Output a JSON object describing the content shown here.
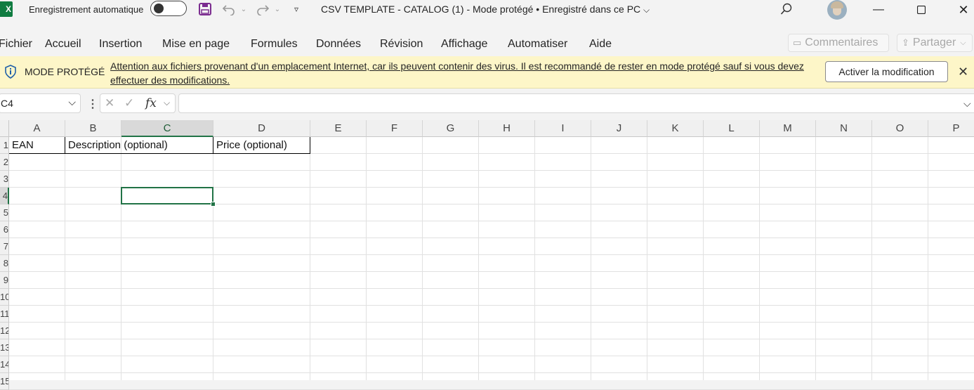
{
  "titlebar": {
    "app_badge": "X",
    "autosave_label": "Enregistrement automatique",
    "doc_title": "CSV TEMPLATE - CATALOG (1)  -  Mode protégé • Enregistré dans ce PC"
  },
  "menu": {
    "items": [
      "Fichier",
      "Accueil",
      "Insertion",
      "Mise en page",
      "Formules",
      "Données",
      "Révision",
      "Affichage",
      "Automatiser",
      "Aide"
    ],
    "comments_label": "Commentaires",
    "share_label": "Partager"
  },
  "banner": {
    "title": "MODE PROTÉGÉ",
    "message": "Attention aux fichiers provenant d'un emplacement Internet, car ils peuvent contenir des virus. Il est recommandé de rester en mode protégé sauf si vous devez effectuer des modifications.",
    "enable_label": "Activer la modification"
  },
  "formula_bar": {
    "name_box": "C4",
    "formula": ""
  },
  "sheet": {
    "columns": [
      "A",
      "B",
      "C",
      "D",
      "E",
      "F",
      "G",
      "H",
      "I",
      "J",
      "K",
      "L",
      "M",
      "N",
      "O",
      "P"
    ],
    "selected_column": "C",
    "row_labels": [
      "1",
      "2",
      "3",
      "4",
      "5",
      "6",
      "7",
      "8",
      "9",
      "10",
      "11",
      "12",
      "13",
      "14",
      "15"
    ],
    "selected_row": "4",
    "header_cells": {
      "A1": "EAN",
      "B1": "Description (optional)",
      "D1": "Price (optional)"
    }
  },
  "colors": {
    "excel_green": "#217346",
    "banner_bg": "#fdf6c8",
    "save_icon": "#7b2c8f"
  }
}
